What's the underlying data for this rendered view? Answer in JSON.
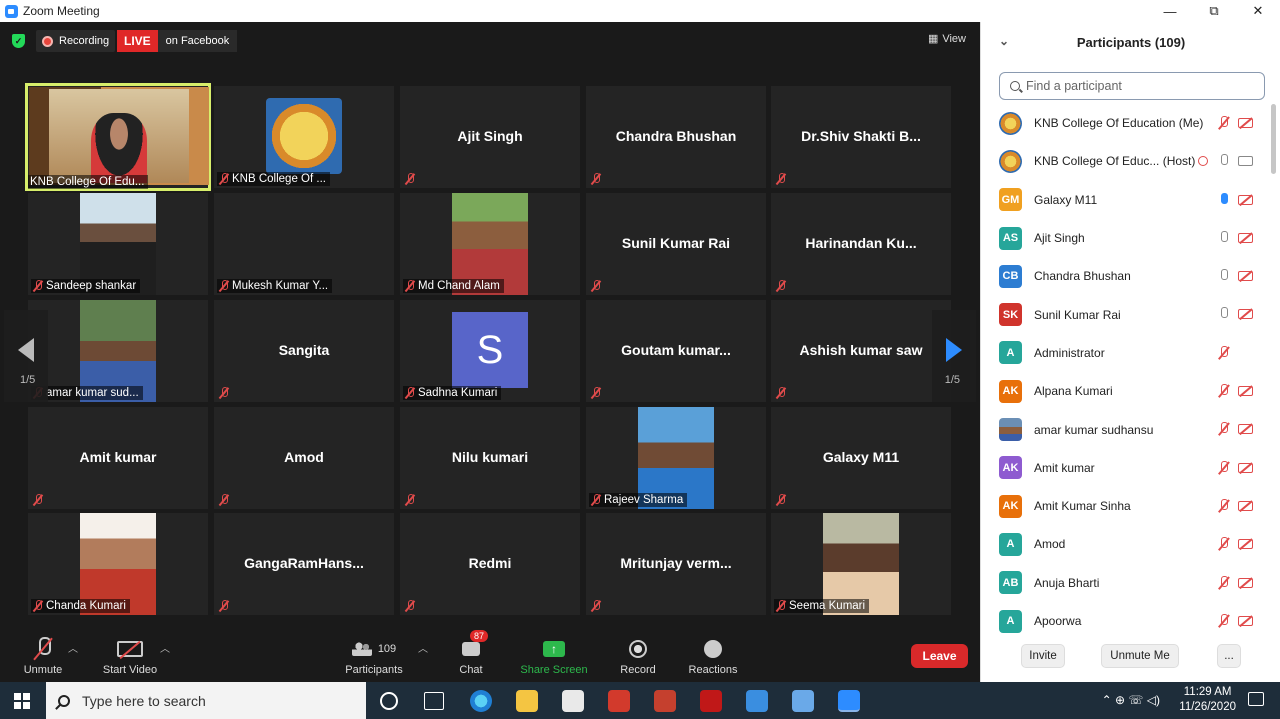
{
  "window": {
    "title": "Zoom Meeting",
    "controls": [
      "—",
      "⧉",
      "✕"
    ]
  },
  "topbar": {
    "recording": "Recording",
    "live": "LIVE",
    "live_target": "on Facebook",
    "view": "View"
  },
  "gallery": {
    "page_left": "1/5",
    "page_right": "1/5",
    "tiles": [
      {
        "name": "KNB College Of Edu...",
        "kind": "active"
      },
      {
        "name": "KNB College Of ...",
        "kind": "logo"
      },
      {
        "name": "Ajit Singh",
        "kind": "text"
      },
      {
        "name": "Chandra Bhushan",
        "kind": "text"
      },
      {
        "name": "Dr.Shiv  Shakti  B...",
        "kind": "text"
      },
      {
        "name": "Sandeep shankar",
        "kind": "video"
      },
      {
        "name": "Mukesh Kumar Y...",
        "kind": "blank"
      },
      {
        "name": "Md Chand Alam",
        "kind": "video"
      },
      {
        "name": "Sunil Kumar Rai",
        "kind": "text"
      },
      {
        "name": "Harinandan  Ku...",
        "kind": "text"
      },
      {
        "name": "amar kumar sud...",
        "kind": "video"
      },
      {
        "name": "Sangita",
        "kind": "text"
      },
      {
        "name": "Sadhna Kumari",
        "kind": "avatar",
        "initial": "S"
      },
      {
        "name": "Goutam  kumar...",
        "kind": "text"
      },
      {
        "name": "Ashish kumar saw",
        "kind": "text"
      },
      {
        "name": "Amit kumar",
        "kind": "text"
      },
      {
        "name": "Amod",
        "kind": "text"
      },
      {
        "name": "Nilu kumari",
        "kind": "text"
      },
      {
        "name": "Rajeev Sharma",
        "kind": "video"
      },
      {
        "name": "Galaxy M11",
        "kind": "text"
      },
      {
        "name": "Chanda Kumari",
        "kind": "video"
      },
      {
        "name": "GangaRamHans...",
        "kind": "text"
      },
      {
        "name": "Redmi",
        "kind": "text"
      },
      {
        "name": "Mritunjay  verm...",
        "kind": "text"
      },
      {
        "name": "Seema Kumari",
        "kind": "video"
      }
    ]
  },
  "toolbar": {
    "unmute": "Unmute",
    "start_video": "Start Video",
    "participants": "Participants",
    "participants_count": "109",
    "chat": "Chat",
    "chat_badge": "87",
    "share_screen": "Share Screen",
    "record": "Record",
    "reactions": "Reactions",
    "leave": "Leave"
  },
  "panel": {
    "title": "Participants (109)",
    "search_placeholder": "Find a participant",
    "participants": [
      {
        "initials": "",
        "avatar": "logo",
        "name": "KNB College Of Education (Me)",
        "mic": "muted",
        "cam": "off"
      },
      {
        "initials": "",
        "avatar": "logo",
        "name": "KNB College Of Educ... (Host)",
        "mic": "on",
        "cam": "on",
        "rec": true
      },
      {
        "initials": "GM",
        "color": "#f0a020",
        "name": "Galaxy M11",
        "mic": "raised",
        "cam": "off"
      },
      {
        "initials": "AS",
        "color": "#26a69a",
        "name": "Ajit Singh",
        "mic": "on",
        "cam": "off"
      },
      {
        "initials": "CB",
        "color": "#2d7dd2",
        "name": "Chandra Bhushan",
        "mic": "on",
        "cam": "off"
      },
      {
        "initials": "SK",
        "color": "#d0342c",
        "name": "Sunil Kumar Rai",
        "mic": "on",
        "cam": "off"
      },
      {
        "initials": "A",
        "color": "#26a69a",
        "name": "Administrator",
        "mic": "muted",
        "cam": "none"
      },
      {
        "initials": "AK",
        "color": "#e8700a",
        "name": "Alpana Kumari",
        "mic": "muted",
        "cam": "off"
      },
      {
        "initials": "",
        "avatar": "photo",
        "name": "amar kumar sudhansu",
        "mic": "muted",
        "cam": "off"
      },
      {
        "initials": "AK",
        "color": "#8e5bd0",
        "name": "Amit kumar",
        "mic": "muted",
        "cam": "off"
      },
      {
        "initials": "AK",
        "color": "#e8700a",
        "name": "Amit Kumar Sinha",
        "mic": "muted",
        "cam": "off"
      },
      {
        "initials": "A",
        "color": "#26a69a",
        "name": "Amod",
        "mic": "muted",
        "cam": "off"
      },
      {
        "initials": "AB",
        "color": "#26a69a",
        "name": "Anuja Bharti",
        "mic": "muted",
        "cam": "off"
      },
      {
        "initials": "A",
        "color": "#26a69a",
        "name": "Apoorwa",
        "mic": "muted",
        "cam": "off"
      }
    ],
    "invite": "Invite",
    "unmute_me": "Unmute Me",
    "more": "..."
  },
  "taskbar": {
    "search_placeholder": "Type here to search",
    "time": "11:29 AM",
    "date": "11/26/2020",
    "tray": "⌃  ⊕  ☏  ◁)"
  }
}
